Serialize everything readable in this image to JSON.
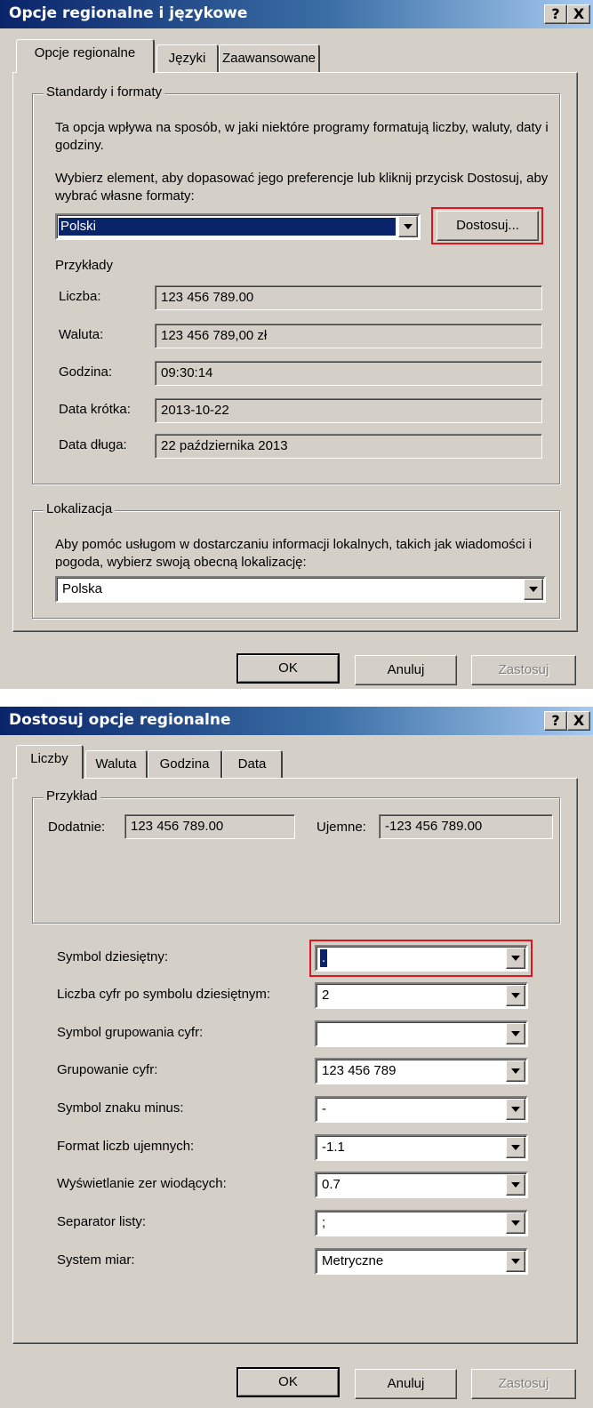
{
  "dialog1": {
    "title": "Opcje regionalne i językowe",
    "help_button": "?",
    "close_button": "X",
    "tabs": [
      "Opcje regionalne",
      "Języki",
      "Zaawansowane"
    ],
    "standards": {
      "group_title": "Standardy i formaty",
      "description": "Ta opcja wpływa na sposób, w jaki niektóre programy formatują liczby, waluty, daty i godziny.",
      "instruction": "Wybierz element, aby dopasować jego preferencje lub kliknij przycisk Dostosuj, aby wybrać własne formaty:",
      "selected_locale": "Polski",
      "customize_button": "Dostosuj...",
      "examples_title": "Przykłady",
      "examples": [
        {
          "label": "Liczba:",
          "value": "123 456 789.00"
        },
        {
          "label": "Waluta:",
          "value": "123 456 789,00 zł"
        },
        {
          "label": "Godzina:",
          "value": "09:30:14"
        },
        {
          "label": "Data krótka:",
          "value": "2013-10-22"
        },
        {
          "label": "Data długa:",
          "value": "22 października 2013"
        }
      ]
    },
    "location": {
      "group_title": "Lokalizacja",
      "description": "Aby pomóc usługom w dostarczaniu informacji lokalnych, takich jak wiadomości i pogoda, wybierz swoją obecną lokalizację:",
      "selected": "Polska"
    },
    "buttons": {
      "ok": "OK",
      "cancel": "Anuluj",
      "apply": "Zastosuj"
    }
  },
  "dialog2": {
    "title": "Dostosuj opcje regionalne",
    "help_button": "?",
    "close_button": "X",
    "tabs": [
      "Liczby",
      "Waluta",
      "Godzina",
      "Data"
    ],
    "sample": {
      "group_title": "Przykład",
      "positive_label": "Dodatnie:",
      "positive_value": "123 456 789.00",
      "negative_label": "Ujemne:",
      "negative_value": "-123 456 789.00"
    },
    "settings": [
      {
        "label": "Symbol dziesiętny:",
        "value": "."
      },
      {
        "label": "Liczba cyfr po symbolu dziesiętnym:",
        "value": "2"
      },
      {
        "label": "Symbol grupowania cyfr:",
        "value": ""
      },
      {
        "label": "Grupowanie cyfr:",
        "value": "123 456 789"
      },
      {
        "label": "Symbol znaku minus:",
        "value": "-"
      },
      {
        "label": "Format liczb ujemnych:",
        "value": "-1.1"
      },
      {
        "label": "Wyświetlanie zer wiodących:",
        "value": "0.7"
      },
      {
        "label": "Separator listy:",
        "value": ";"
      },
      {
        "label": "System miar:",
        "value": "Metryczne"
      }
    ],
    "buttons": {
      "ok": "OK",
      "cancel": "Anuluj",
      "apply": "Zastosuj"
    }
  }
}
